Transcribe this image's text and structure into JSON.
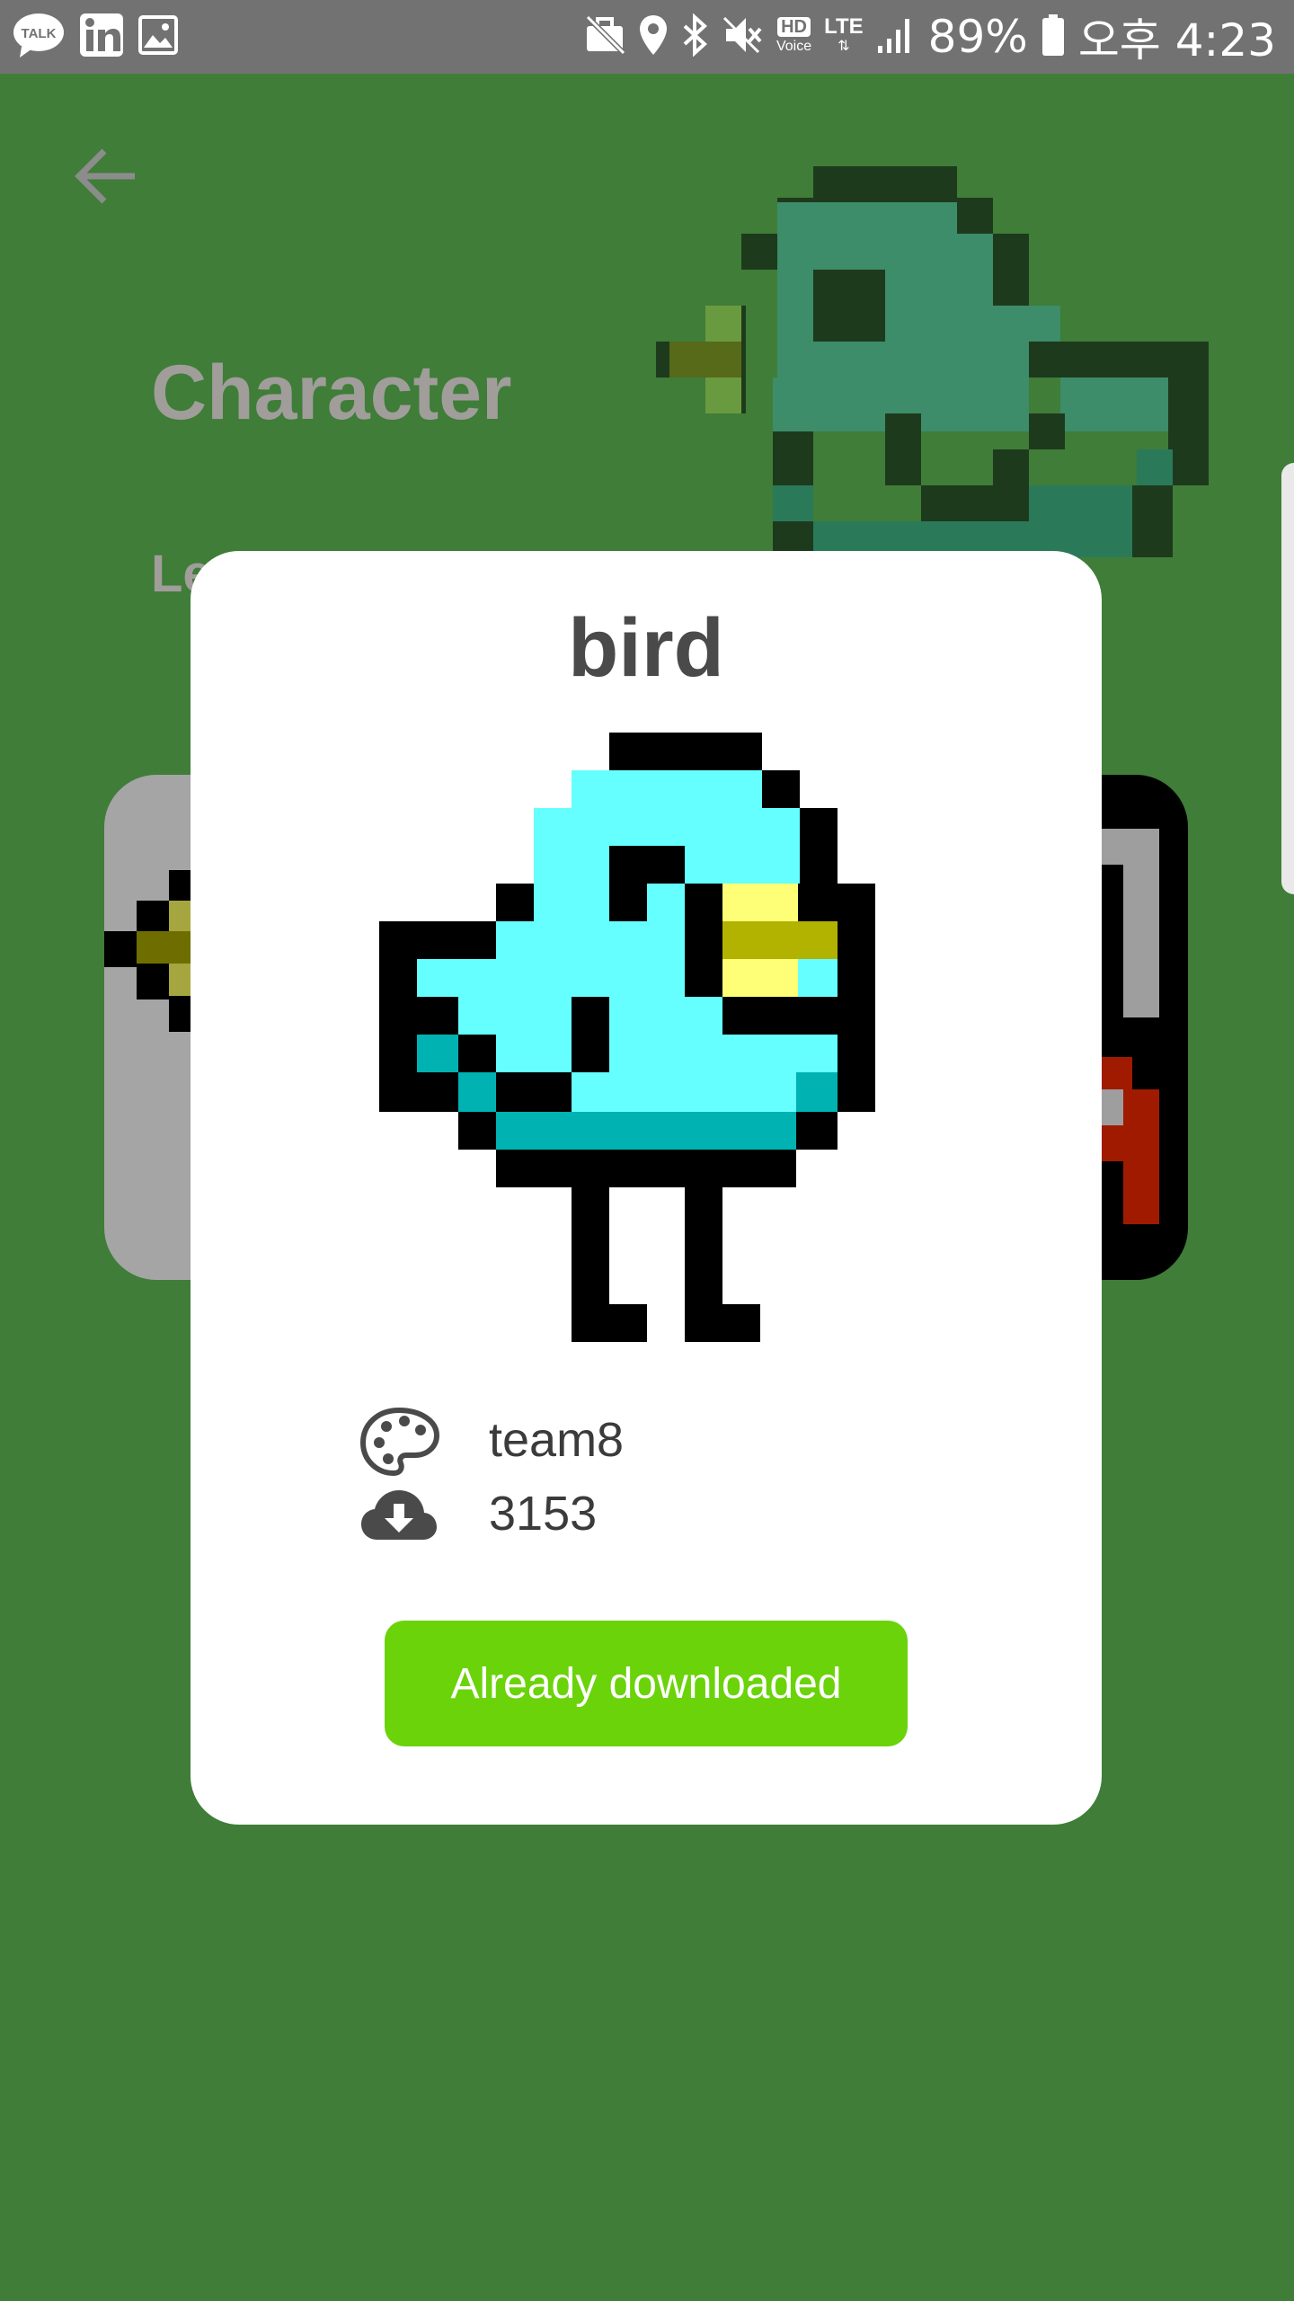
{
  "status_bar": {
    "battery": "89%",
    "time": "오후 4:23",
    "hd_label": "HD",
    "voice_label": "Voice",
    "lte_label": "LTE",
    "icons": [
      "talk-icon",
      "linkedin-icon",
      "gallery-icon",
      "no-work-icon",
      "location-icon",
      "bluetooth-icon",
      "mute-icon",
      "signal-icon",
      "battery-icon"
    ]
  },
  "background": {
    "title": "Character",
    "subtitle": "Le"
  },
  "dialog": {
    "title": "bird",
    "author": "team8",
    "downloads": "3153",
    "button_label": "Already downloaded"
  },
  "colors": {
    "background": "#3f7d38",
    "button": "#6bd30a",
    "bird_body": "#66ffff",
    "bird_shadow": "#00b2b2",
    "beak": "#ffff77",
    "beak_dark": "#b2b200"
  }
}
